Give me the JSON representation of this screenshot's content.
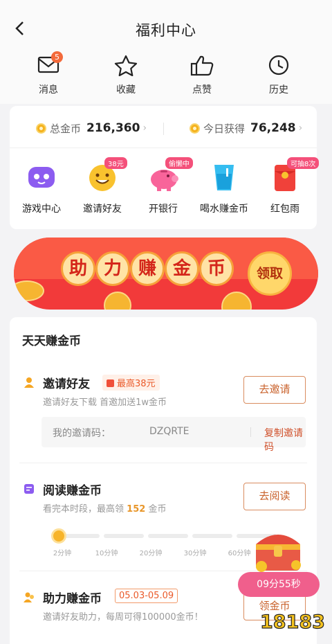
{
  "header": {
    "title": "福利中心",
    "back_icon": "chevron-left-icon"
  },
  "top_nav": [
    {
      "label": "消息",
      "icon": "mail-icon",
      "badge": "5"
    },
    {
      "label": "收藏",
      "icon": "star-icon"
    },
    {
      "label": "点赞",
      "icon": "thumbs-up-icon"
    },
    {
      "label": "历史",
      "icon": "clock-icon"
    }
  ],
  "coins": {
    "total_label": "总金币",
    "total_value": "216,360",
    "today_label": "今日获得",
    "today_value": "76,248"
  },
  "features": [
    {
      "label": "游戏中心",
      "icon": "gamepad-icon"
    },
    {
      "label": "邀请好友",
      "icon": "smiley-icon",
      "tag": "38元"
    },
    {
      "label": "开银行",
      "icon": "piggy-bank-icon",
      "tag": "偷懒中"
    },
    {
      "label": "喝水赚金币",
      "icon": "water-cup-icon"
    },
    {
      "label": "红包雨",
      "icon": "red-envelope-icon",
      "tag": "可抽8次"
    }
  ],
  "banner": {
    "chars": [
      "助",
      "力",
      "赚",
      "金",
      "币"
    ],
    "button": "领取"
  },
  "earn": {
    "title": "天天赚金币",
    "invite": {
      "name": "邀请好友",
      "highlight": "最高38元",
      "desc": "邀请好友下载 首邀加送1w金币",
      "button": "去邀请",
      "code_label": "我的邀请码：",
      "code_value": "DZQRTE",
      "copy": "复制邀请码"
    },
    "read": {
      "name": "阅读赚金币",
      "desc_prefix": "看完本时段，最高领",
      "desc_value": "152",
      "desc_suffix": "金币",
      "button": "去阅读",
      "progress_fraction": 0.0,
      "ticks": [
        "2分钟",
        "10分钟",
        "20分钟",
        "30分钟",
        "60分钟"
      ]
    },
    "boost": {
      "name": "助力赚金币",
      "date": "05.03-05.09",
      "desc": "邀请好友助力，每周可得100000金币！",
      "button": "领金币"
    }
  },
  "floating": {
    "timer": "09分55秒",
    "watermark": "18183"
  },
  "colors": {
    "accent": "#f05f8c",
    "coin": "#f5b21c",
    "button_text": "#c9622c",
    "banner": "#f23a3a"
  }
}
